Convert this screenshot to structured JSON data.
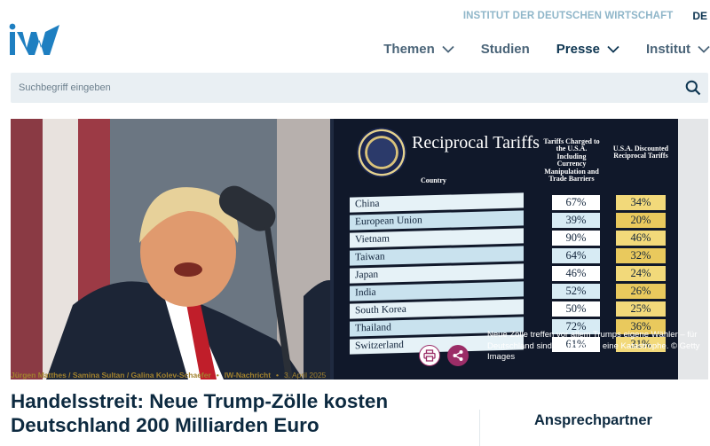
{
  "topbar": {
    "institute_name": "INSTITUT DER DEUTSCHEN WIRTSCHAFT",
    "language": "DE"
  },
  "logo": {
    "text": "IW"
  },
  "nav": {
    "items": [
      {
        "label": "Themen",
        "has_dropdown": true
      },
      {
        "label": "Studien",
        "has_dropdown": false
      },
      {
        "label": "Presse",
        "has_dropdown": true,
        "active": true
      },
      {
        "label": "Institut",
        "has_dropdown": true
      }
    ]
  },
  "search": {
    "placeholder": "Suchbegriff eingeben",
    "value": "",
    "icon": "search-icon"
  },
  "hero": {
    "board": {
      "title": "Reciprocal Tariffs",
      "col_country": "Country",
      "col_charged": "Tariffs Charged to the U.S.A. Including Currency Manipulation and Trade Barriers",
      "col_discounted": "U.S.A. Discounted Reciprocal Tariffs",
      "rows": [
        {
          "country": "China",
          "charged": "67%",
          "discounted": "34%"
        },
        {
          "country": "European Union",
          "charged": "39%",
          "discounted": "20%"
        },
        {
          "country": "Vietnam",
          "charged": "90%",
          "discounted": "46%"
        },
        {
          "country": "Taiwan",
          "charged": "64%",
          "discounted": "32%"
        },
        {
          "country": "Japan",
          "charged": "46%",
          "discounted": "24%"
        },
        {
          "country": "India",
          "charged": "52%",
          "discounted": "26%"
        },
        {
          "country": "South Korea",
          "charged": "50%",
          "discounted": "25%"
        },
        {
          "country": "Thailand",
          "charged": "72%",
          "discounted": "36%"
        },
        {
          "country": "Switzerland",
          "charged": "61%",
          "discounted": "31%"
        }
      ]
    },
    "caption": "Neue Zölle treffen vor allem Trumps eigene Wähler – für Deutschland sind sie trotzdem eine Katastrophe. © Getty Images"
  },
  "article": {
    "authors": "Jürgen Matthes / Samina Sultan / Galina Kolev-Schaefer",
    "type": "IW-Nachricht",
    "date": "3. April 2025",
    "headline": "Handelsstreit: Neue Trump-Zölle kosten Deutschland 200 Milliarden Euro"
  },
  "actions": {
    "print_icon": "print-icon",
    "share_icon": "share-icon"
  },
  "sidebar": {
    "contact_title": "Ansprechpartner"
  },
  "colors": {
    "brand_blue": "#1e7fc1",
    "navy": "#0d3551",
    "accent_purple": "#9b2d67",
    "meta_gold": "#a2822e",
    "search_bg": "#e9eff3"
  }
}
